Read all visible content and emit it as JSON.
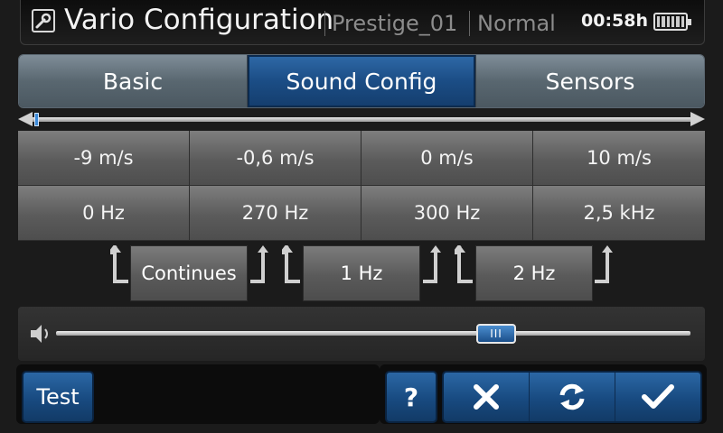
{
  "header": {
    "title": "Vario Configuration",
    "profile": "Prestige_01",
    "mode": "Normal",
    "time": "00:58h",
    "icons": {
      "app": "wrench-icon",
      "battery": "battery-icon"
    }
  },
  "tabs": [
    {
      "label": "Basic",
      "active": false
    },
    {
      "label": "Sound Config",
      "active": true
    },
    {
      "label": "Sensors",
      "active": false
    }
  ],
  "speed_row": [
    "-9 m/s",
    "-0,6 m/s",
    "0 m/s",
    "10 m/s"
  ],
  "freq_row": [
    "0 Hz",
    "270 Hz",
    "300 Hz",
    "2,5 kHz"
  ],
  "steps": [
    "Continues",
    "1 Hz",
    "2 Hz"
  ],
  "volume": {
    "level": 0.69,
    "thumb_label": "III",
    "icon": "speaker-icon"
  },
  "bottom": {
    "test_label": "Test",
    "help_label": "?",
    "icons": [
      "close-icon",
      "refresh-icon",
      "check-icon"
    ]
  },
  "colors": {
    "accent": "#1b4d85",
    "panel": "#5b5b5b"
  }
}
